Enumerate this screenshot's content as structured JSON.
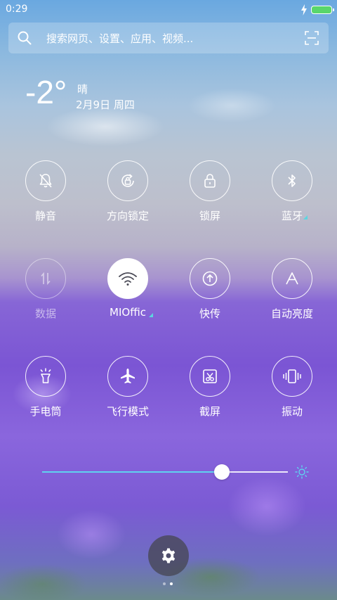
{
  "status_bar": {
    "time": "0:29",
    "icons": [
      "charging-icon",
      "battery-icon"
    ]
  },
  "search": {
    "placeholder": "搜索网页、设置、应用、视频...",
    "icons": [
      "search-icon",
      "scan-icon"
    ]
  },
  "weather": {
    "temperature": "-2°",
    "condition": "晴",
    "date": "2月9日 周四"
  },
  "toggles": [
    {
      "label": "静音",
      "icon": "mute-bell-icon",
      "state": "off"
    },
    {
      "label": "方向锁定",
      "icon": "rotation-lock-icon",
      "state": "off"
    },
    {
      "label": "锁屏",
      "icon": "lock-icon",
      "state": "off"
    },
    {
      "label": "蓝牙",
      "icon": "bluetooth-icon",
      "state": "off",
      "has_more": true
    },
    {
      "label": "数据",
      "icon": "mobile-data-icon",
      "state": "disabled"
    },
    {
      "label": "MIOffic",
      "icon": "wifi-icon",
      "state": "on",
      "has_more": true
    },
    {
      "label": "快传",
      "icon": "quick-transfer-icon",
      "state": "off"
    },
    {
      "label": "自动亮度",
      "icon": "auto-brightness-icon",
      "state": "off"
    },
    {
      "label": "手电筒",
      "icon": "flashlight-icon",
      "state": "off"
    },
    {
      "label": "飞行模式",
      "icon": "airplane-icon",
      "state": "off"
    },
    {
      "label": "截屏",
      "icon": "screenshot-icon",
      "state": "off"
    },
    {
      "label": "振动",
      "icon": "vibrate-icon",
      "state": "off"
    }
  ],
  "brightness": {
    "level": 0.73,
    "icon": "sun-icon"
  },
  "settings_button": {
    "icon": "gear-icon"
  },
  "pager": {
    "pages": 2,
    "current": 2
  },
  "colors": {
    "accent": "#5fd2f0",
    "battery": "#59d66b",
    "more_mark": "#5cd5e0"
  }
}
